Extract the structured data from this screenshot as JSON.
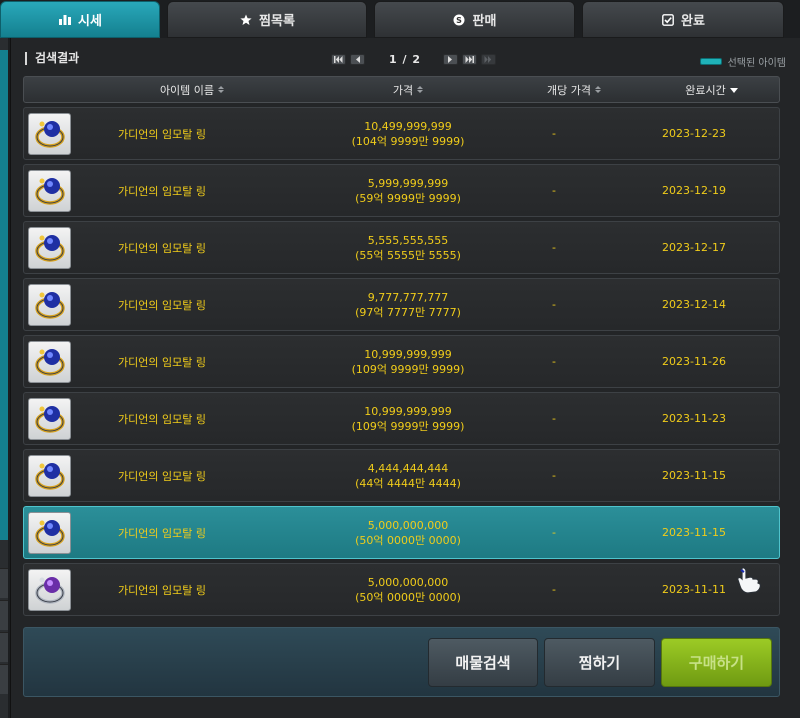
{
  "tabs": [
    {
      "label": "시세",
      "icon": "bar-chart-icon",
      "active": true
    },
    {
      "label": "찜목록",
      "icon": "star-icon",
      "active": false
    },
    {
      "label": "판매",
      "icon": "coin-icon",
      "active": false
    },
    {
      "label": "완료",
      "icon": "checkbox-icon",
      "active": false
    }
  ],
  "results": {
    "title": "검색결과",
    "page": "1 / 2",
    "legend_label": "선택된 아이템"
  },
  "columns": {
    "name": "아이템 이름",
    "price": "가격",
    "unit_price": "개당 가격",
    "completed_time": "완료시간"
  },
  "rows": [
    {
      "name": "가디언의 임모탈 링",
      "price": "10,499,999,999",
      "price_kr": "(104억 9999만 9999)",
      "unit_price": "-",
      "date": "2023-12-23",
      "selected": false
    },
    {
      "name": "가디언의 임모탈 링",
      "price": "5,999,999,999",
      "price_kr": "(59억 9999만 9999)",
      "unit_price": "-",
      "date": "2023-12-19",
      "selected": false
    },
    {
      "name": "가디언의 임모탈 링",
      "price": "5,555,555,555",
      "price_kr": "(55억 5555만 5555)",
      "unit_price": "-",
      "date": "2023-12-17",
      "selected": false
    },
    {
      "name": "가디언의 임모탈 링",
      "price": "9,777,777,777",
      "price_kr": "(97억 7777만 7777)",
      "unit_price": "-",
      "date": "2023-12-14",
      "selected": false
    },
    {
      "name": "가디언의 임모탈 링",
      "price": "10,999,999,999",
      "price_kr": "(109억 9999만 9999)",
      "unit_price": "-",
      "date": "2023-11-26",
      "selected": false
    },
    {
      "name": "가디언의 임모탈 링",
      "price": "10,999,999,999",
      "price_kr": "(109억 9999만 9999)",
      "unit_price": "-",
      "date": "2023-11-23",
      "selected": false
    },
    {
      "name": "가디언의 임모탈 링",
      "price": "4,444,444,444",
      "price_kr": "(44억 4444만 4444)",
      "unit_price": "-",
      "date": "2023-11-15",
      "selected": false
    },
    {
      "name": "가디언의 임모탈 링",
      "price": "5,000,000,000",
      "price_kr": "(50억 0000만 0000)",
      "unit_price": "-",
      "date": "2023-11-15",
      "selected": true
    },
    {
      "name": "가디언의 임모탈 링",
      "price": "5,000,000,000",
      "price_kr": "(50억 0000만 0000)",
      "unit_price": "-",
      "date": "2023-11-11",
      "selected": false
    }
  ],
  "buttons": {
    "search": "매물검색",
    "wishlist": "찜하기",
    "buy": "구매하기"
  },
  "colors": {
    "accent": "#1b93a3",
    "selected_row": "#2b8f99",
    "price_text": "#f0cc1a",
    "buy_button": "#86b21c"
  }
}
